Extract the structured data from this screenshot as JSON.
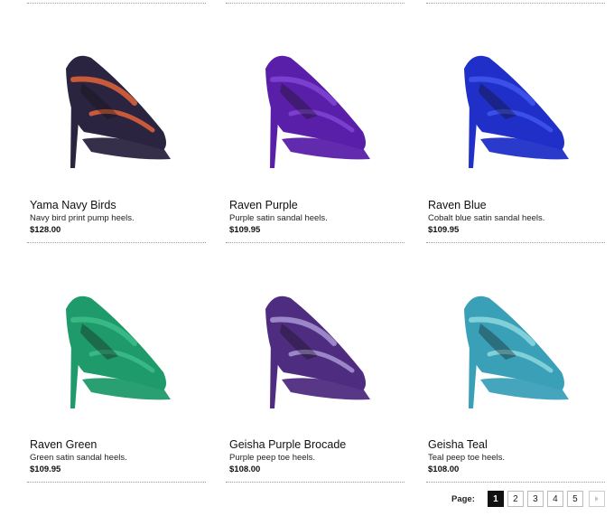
{
  "products": [
    {
      "name": "Yama Navy Birds",
      "description": "Navy bird print pump heels.",
      "price": "$128.00",
      "image_icon": "navy-bird-print-pump-heel",
      "color": "#2a2440",
      "accent": "#c85a3a"
    },
    {
      "name": "Raven Purple",
      "description": "Purple satin sandal heels.",
      "price": "$109.95",
      "image_icon": "purple-satin-sandal-heel",
      "color": "#5a1fa8",
      "accent": "#7b3fd0"
    },
    {
      "name": "Raven Blue",
      "description": "Cobalt blue satin sandal heels.",
      "price": "$109.95",
      "image_icon": "cobalt-blue-satin-sandal-heel",
      "color": "#1f2fc8",
      "accent": "#3b50e8"
    },
    {
      "name": "Raven Green",
      "description": "Green satin sandal heels.",
      "price": "$109.95",
      "image_icon": "green-satin-sandal-heel",
      "color": "#1f9a6a",
      "accent": "#38b884"
    },
    {
      "name": "Geisha Purple Brocade",
      "description": "Purple peep toe heels.",
      "price": "$108.00",
      "image_icon": "purple-brocade-peep-toe-heel",
      "color": "#4e2c80",
      "accent": "#9b86c8"
    },
    {
      "name": "Geisha Teal",
      "description": "Teal peep toe heels.",
      "price": "$108.00",
      "image_icon": "teal-peep-toe-heel",
      "color": "#3aa0b8",
      "accent": "#7fd0d8"
    }
  ],
  "pagination": {
    "label": "Page:",
    "pages": [
      "1",
      "2",
      "3",
      "4",
      "5"
    ],
    "current": "1",
    "next_icon": "next-arrow-icon"
  }
}
